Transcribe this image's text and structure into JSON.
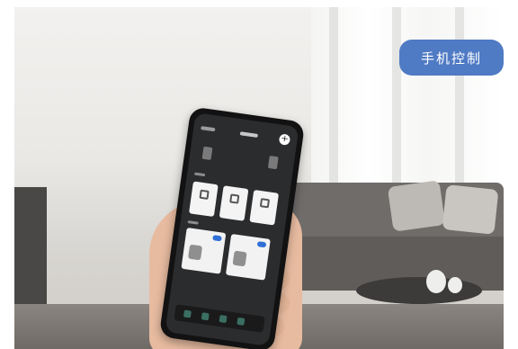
{
  "badge": {
    "label": "手机控制",
    "color": "#4f7ac4"
  },
  "scene": {
    "phone_screen_color": "#2b2c2e",
    "toggle_color": "#2f6fd6"
  }
}
